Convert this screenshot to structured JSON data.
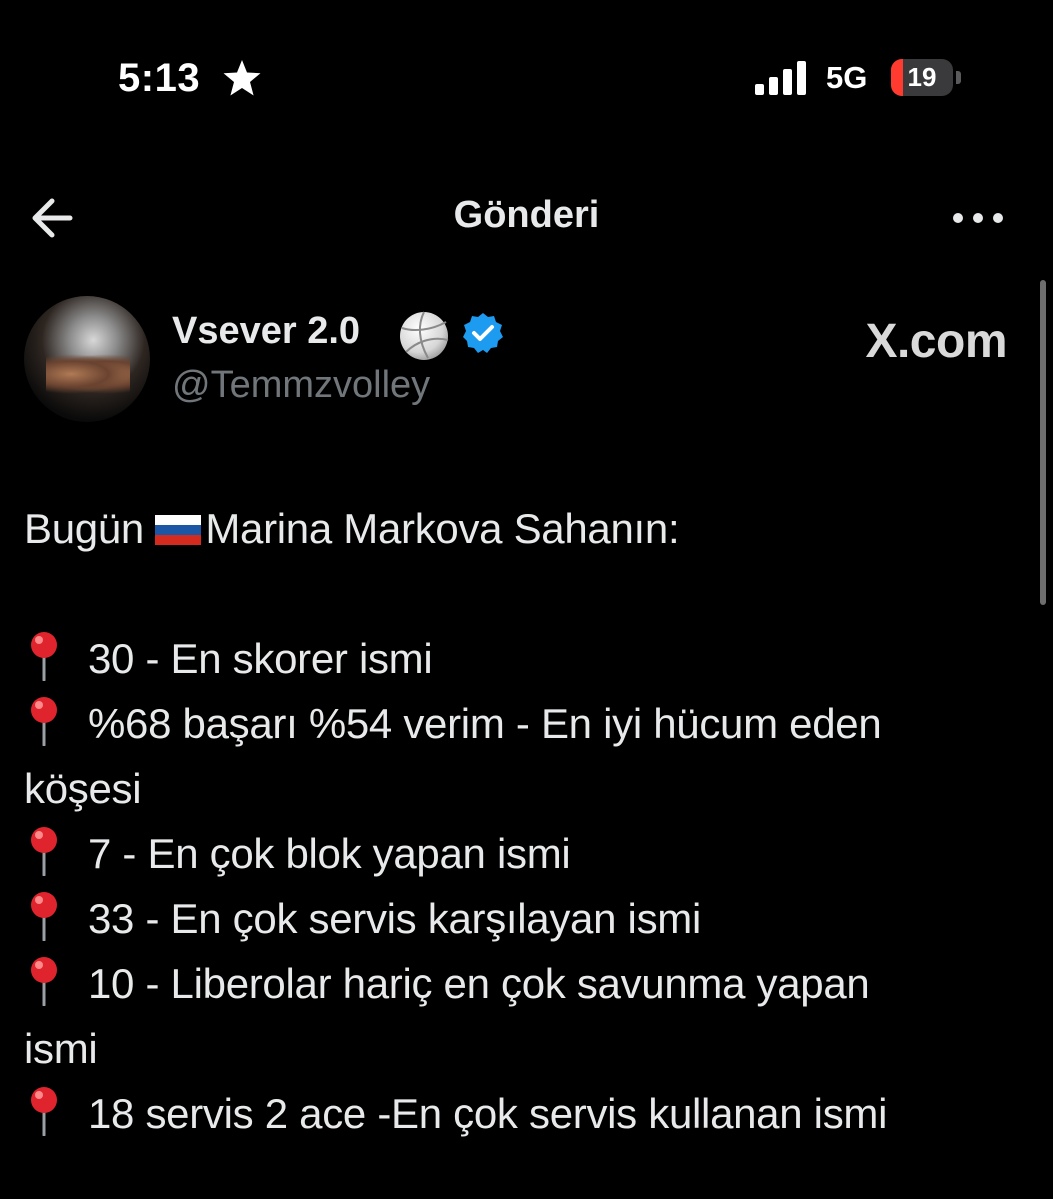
{
  "status_bar": {
    "time": "5:13",
    "network": "5G",
    "battery_level": "19",
    "battery_fraction": 0.19
  },
  "nav": {
    "title": "Gönderi"
  },
  "post": {
    "display_name": "Vsever 2.0",
    "handle": "@Temmzvolley",
    "source": "X.com",
    "intro": "Bugün",
    "intro_name": "Marina Markova Sahanın:",
    "items": [
      "30 - En skorer ismi",
      "%68 başarı %54 verim - En iyi hücum eden",
      "köşesi",
      "7 - En çok blok yapan ismi",
      "33 - En çok servis karşılayan ismi",
      "10 - Liberolar hariç en çok savunma yapan",
      "ismi",
      "18 servis 2 ace -En çok servis kullanan ismi"
    ]
  },
  "icons": {
    "star": "star-icon",
    "signal": "signal-icon",
    "back": "arrow-left-icon",
    "more": "more-horizontal-icon",
    "volleyball": "volleyball-icon",
    "verified": "verified-badge-icon",
    "flag": "russia-flag-icon",
    "pin": "pushpin-icon"
  },
  "colors": {
    "background": "#000000",
    "text": "#e7e9ea",
    "muted": "#71767b",
    "verified": "#1d9bf0",
    "battery_low": "#ff3b30",
    "pin": "#e0242e"
  }
}
